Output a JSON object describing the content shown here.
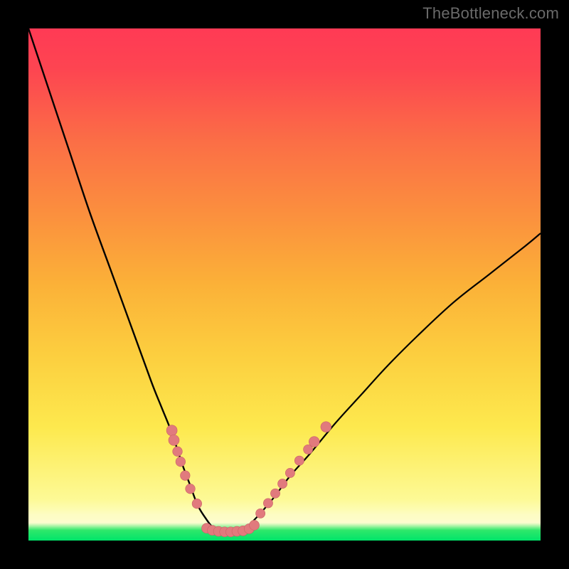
{
  "watermark": "TheBottleneck.com",
  "colors": {
    "frame": "#000000",
    "curve": "#000000",
    "marker_fill": "#e17a7d",
    "marker_stroke": "#c96265"
  },
  "chart_data": {
    "type": "line",
    "title": "",
    "xlabel": "",
    "ylabel": "",
    "xlim": [
      0,
      100
    ],
    "ylim": [
      0,
      100
    ],
    "grid": false,
    "left_curve": {
      "x": [
        0,
        4,
        8,
        12,
        16,
        20,
        24,
        26,
        28,
        30,
        31.5,
        33,
        34.5,
        36,
        37
      ],
      "y": [
        100,
        88,
        76,
        64,
        53,
        42,
        31,
        26,
        21,
        15,
        11,
        7,
        4.5,
        2.5,
        1.8
      ]
    },
    "right_curve": {
      "x": [
        41,
        43,
        45,
        48,
        51,
        55,
        60,
        65,
        70,
        76,
        83,
        90,
        97,
        100
      ],
      "y": [
        1.8,
        3,
        5,
        8.5,
        12.5,
        17,
        23,
        28.5,
        34,
        40,
        46.5,
        52,
        57.5,
        60
      ]
    },
    "markers_left": [
      [
        28,
        21.5
      ],
      [
        28.4,
        19.6
      ],
      [
        29.1,
        17.4
      ],
      [
        29.7,
        15.4
      ],
      [
        30.6,
        12.7
      ],
      [
        31.6,
        10.1
      ],
      [
        32.9,
        7.2
      ]
    ],
    "markers_right": [
      [
        45.3,
        5.3
      ],
      [
        46.8,
        7.3
      ],
      [
        48.2,
        9.2
      ],
      [
        49.6,
        11.1
      ],
      [
        51.1,
        13.2
      ],
      [
        52.9,
        15.6
      ],
      [
        54.6,
        17.8
      ],
      [
        55.8,
        19.3
      ],
      [
        58.1,
        22.2
      ]
    ],
    "markers_bottom": [
      [
        34.8,
        2.4
      ],
      [
        35.9,
        2.0
      ],
      [
        37.1,
        1.8
      ],
      [
        38.3,
        1.7
      ],
      [
        39.5,
        1.7
      ],
      [
        40.7,
        1.8
      ],
      [
        41.9,
        1.9
      ],
      [
        43.1,
        2.3
      ],
      [
        44.1,
        3.0
      ]
    ]
  }
}
